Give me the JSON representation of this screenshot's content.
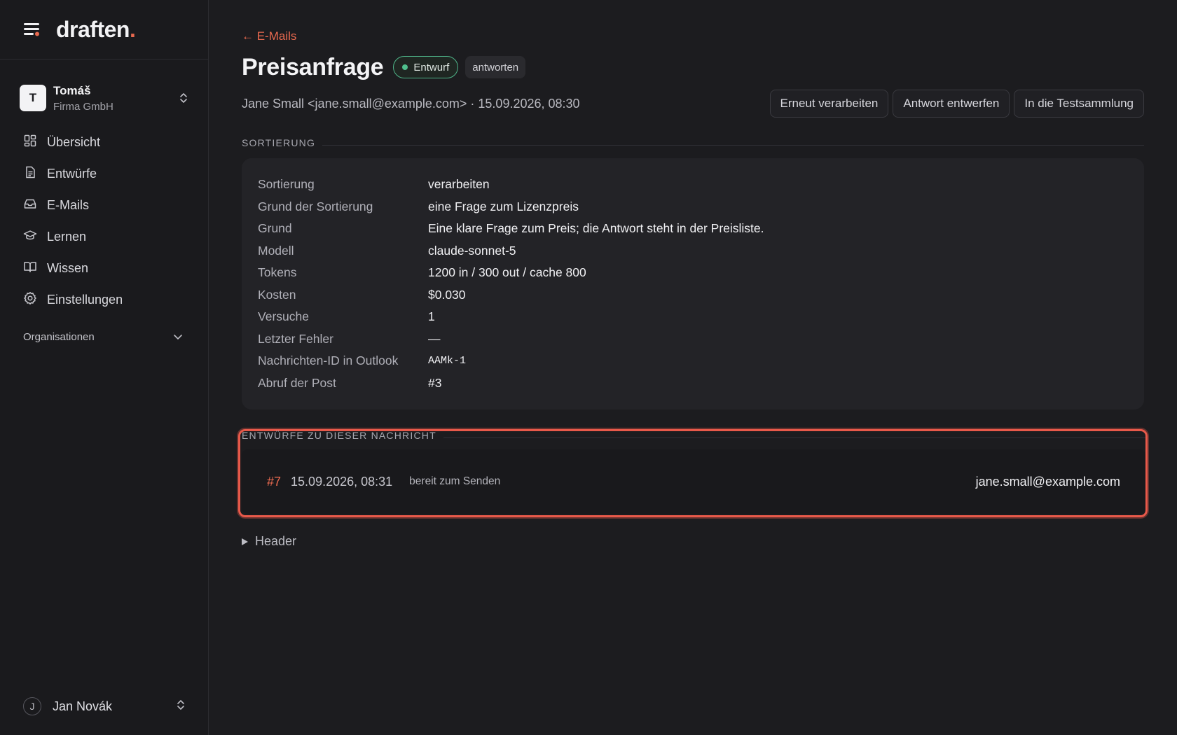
{
  "app": {
    "logo": "draften",
    "logo_dot": "."
  },
  "org": {
    "initial": "T",
    "name": "Tomáš",
    "company": "Firma GmbH"
  },
  "nav": {
    "items": [
      {
        "label": "Übersicht",
        "icon": "grid-icon"
      },
      {
        "label": "Entwürfe",
        "icon": "document-icon"
      },
      {
        "label": "E-Mails",
        "icon": "inbox-icon"
      },
      {
        "label": "Lernen",
        "icon": "graduation-cap-icon"
      },
      {
        "label": "Wissen",
        "icon": "book-icon"
      },
      {
        "label": "Einstellungen",
        "icon": "gear-icon"
      }
    ],
    "section_label": "Organisationen"
  },
  "user": {
    "initial": "J",
    "name": "Jan Novák"
  },
  "page": {
    "back_label": "← E-Mails",
    "title": "Preisanfrage",
    "status_badge": "Entwurf",
    "type_badge": "antworten",
    "meta": "Jane Small <jane.small@example.com> · 15.09.2026, 08:30"
  },
  "actions": {
    "reprocess": "Erneut verarbeiten",
    "draft_reply": "Antwort entwerfen",
    "add_to_test": "In die Testsammlung"
  },
  "sorting": {
    "heading": "SORTIERUNG",
    "rows": [
      {
        "label": "Sortierung",
        "value": "verarbeiten"
      },
      {
        "label": "Grund der Sortierung",
        "value": "eine Frage zum Lizenzpreis"
      },
      {
        "label": "Grund",
        "value": "Eine klare Frage zum Preis; die Antwort steht in der Preisliste."
      },
      {
        "label": "Modell",
        "value": "claude-sonnet-5"
      },
      {
        "label": "Tokens",
        "value": "1200 in / 300 out / cache 800"
      },
      {
        "label": "Kosten",
        "value": "$0.030"
      },
      {
        "label": "Versuche",
        "value": "1"
      },
      {
        "label": "Letzter Fehler",
        "value": "—"
      },
      {
        "label": "Nachrichten-ID in Outlook",
        "value": "AAMk-1"
      },
      {
        "label": "Abruf der Post",
        "value": "#3"
      }
    ]
  },
  "drafts": {
    "heading": "ENTWÜRFE ZU DIESER NACHRICHT",
    "items": [
      {
        "num": "#7",
        "date": "15.09.2026, 08:31",
        "status": "bereit zum Senden",
        "to": "jane.small@example.com"
      }
    ]
  },
  "header_section": {
    "label": "Header"
  },
  "colors": {
    "accent": "#e8694f",
    "status_green": "#4fc08d",
    "highlight": "#e8594a"
  }
}
